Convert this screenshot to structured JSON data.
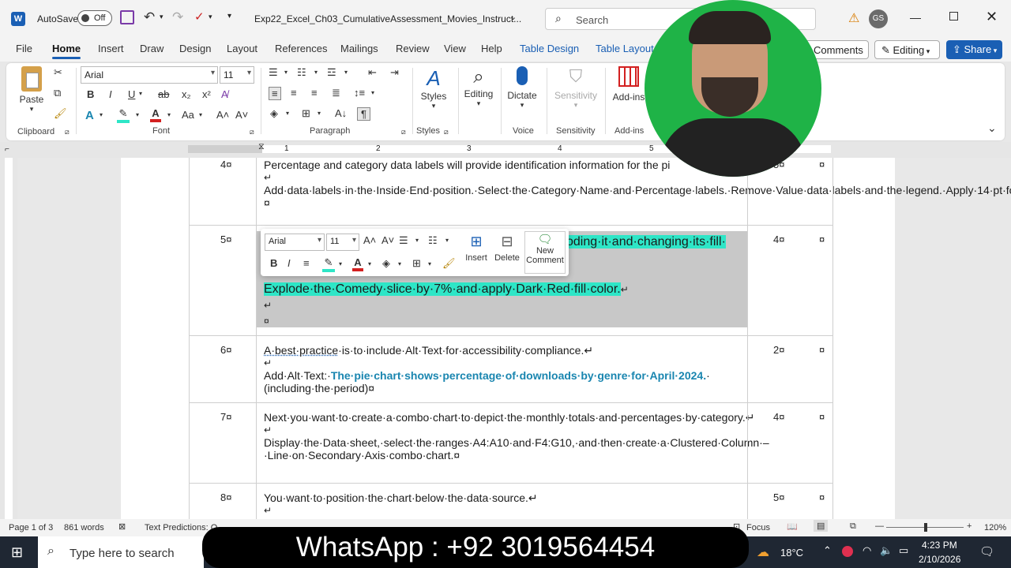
{
  "titlebar": {
    "app_icon": "word-icon",
    "autosave_label": "AutoSave",
    "autosave_state": "Off",
    "doc_title": "Exp22_Excel_Ch03_CumulativeAssessment_Movies_Instruct...",
    "search_placeholder": "Search",
    "user_initials": "GS"
  },
  "tabs": [
    "File",
    "Home",
    "Insert",
    "Draw",
    "Design",
    "Layout",
    "References",
    "Mailings",
    "Review",
    "View",
    "Help",
    "Table Design",
    "Table Layout"
  ],
  "ribbon_right": {
    "comments": "Comments",
    "editing": "Editing",
    "share": "Share"
  },
  "ribbon": {
    "clipboard": {
      "paste": "Paste",
      "label": "Clipboard"
    },
    "font": {
      "name": "Arial",
      "size": "11",
      "label": "Font",
      "case": "Aa"
    },
    "paragraph": {
      "label": "Paragraph"
    },
    "styles": {
      "btn": "Styles",
      "label": "Styles"
    },
    "editing": {
      "btn": "Editing"
    },
    "voice": {
      "btn": "Dictate",
      "label": "Voice"
    },
    "sensitivity": {
      "btn": "Sensitivity",
      "label": "Sensitivity"
    },
    "addins": {
      "btn": "Add-ins",
      "label": "Add-ins"
    }
  },
  "ruler_numbers": [
    "1",
    "2",
    "3",
    "4",
    "5"
  ],
  "rows": [
    {
      "num": "4¤",
      "pts": "5¤",
      "lines": [
        "Percentage and category data labels will provide identification information for the pi",
        "↵",
        "Add·data·labels·in·the·Inside·End·position.·Select·the·Category·Name·and·Percentage·labels.·Remove·Value·data·labels·and·the·legend.·Apply·14·pt·font·size·and·Black,·Text·1·font·color·to·the·data·labels.¤"
      ]
    },
    {
      "num": "5¤",
      "pts": "4¤",
      "partial": "oding·it·and·changing·its·fill·",
      "explode": "Explode·the·Comedy·slice·by·7%·and·apply·Dark·Red·fill·color.",
      "ret": "↵",
      "ret2": "↵",
      "cell_end": "¤"
    },
    {
      "num": "6¤",
      "pts": "2¤",
      "l1a": "A·best·practice",
      "l1b": "·is·to·include·Alt·Text·for·accessibility·compliance.↵",
      "ret": "↵",
      "alt_prefix": "Add·Alt·Text:·",
      "alt_text": "The·pie·chart·shows·percentage·of·downloads·by·genre·for·April·2024.",
      "alt_suffix": "·",
      "l3": "(including·the·period)¤"
    },
    {
      "num": "7¤",
      "pts": "4¤",
      "l1": "Next·you·want·to·create·a·combo·chart·to·depict·the·monthly·totals·and·percentages·by·category.↵",
      "ret": "↵",
      "l2": "Display·the·Data·sheet,·select·the·ranges·A4:A10·and·F4:G10,·and·then·create·a·Clustered·Column·–·Line·on·Secondary·Axis·combo·chart.¤"
    },
    {
      "num": "8¤",
      "pts": "5¤",
      "l1": "You·want·to·position·the·chart·below·the·data·source.↵",
      "ret": "↵"
    }
  ],
  "cell_marker": "¤",
  "minitoolbar": {
    "font": "Arial",
    "size": "11",
    "insert": "Insert",
    "delete": "Delete",
    "new_comment_1": "New",
    "new_comment_2": "Comment"
  },
  "status": {
    "page": "Page 1 of 3",
    "words": "861 words",
    "predictions": "Text Predictions: O",
    "focus": "Focus",
    "zoom": "120%"
  },
  "taskbar": {
    "search_placeholder": "Type here to search",
    "temp": "18°C",
    "time": "4:23 PM",
    "date": "2/10/2026"
  },
  "banner": "WhatsApp : +92 3019564454"
}
